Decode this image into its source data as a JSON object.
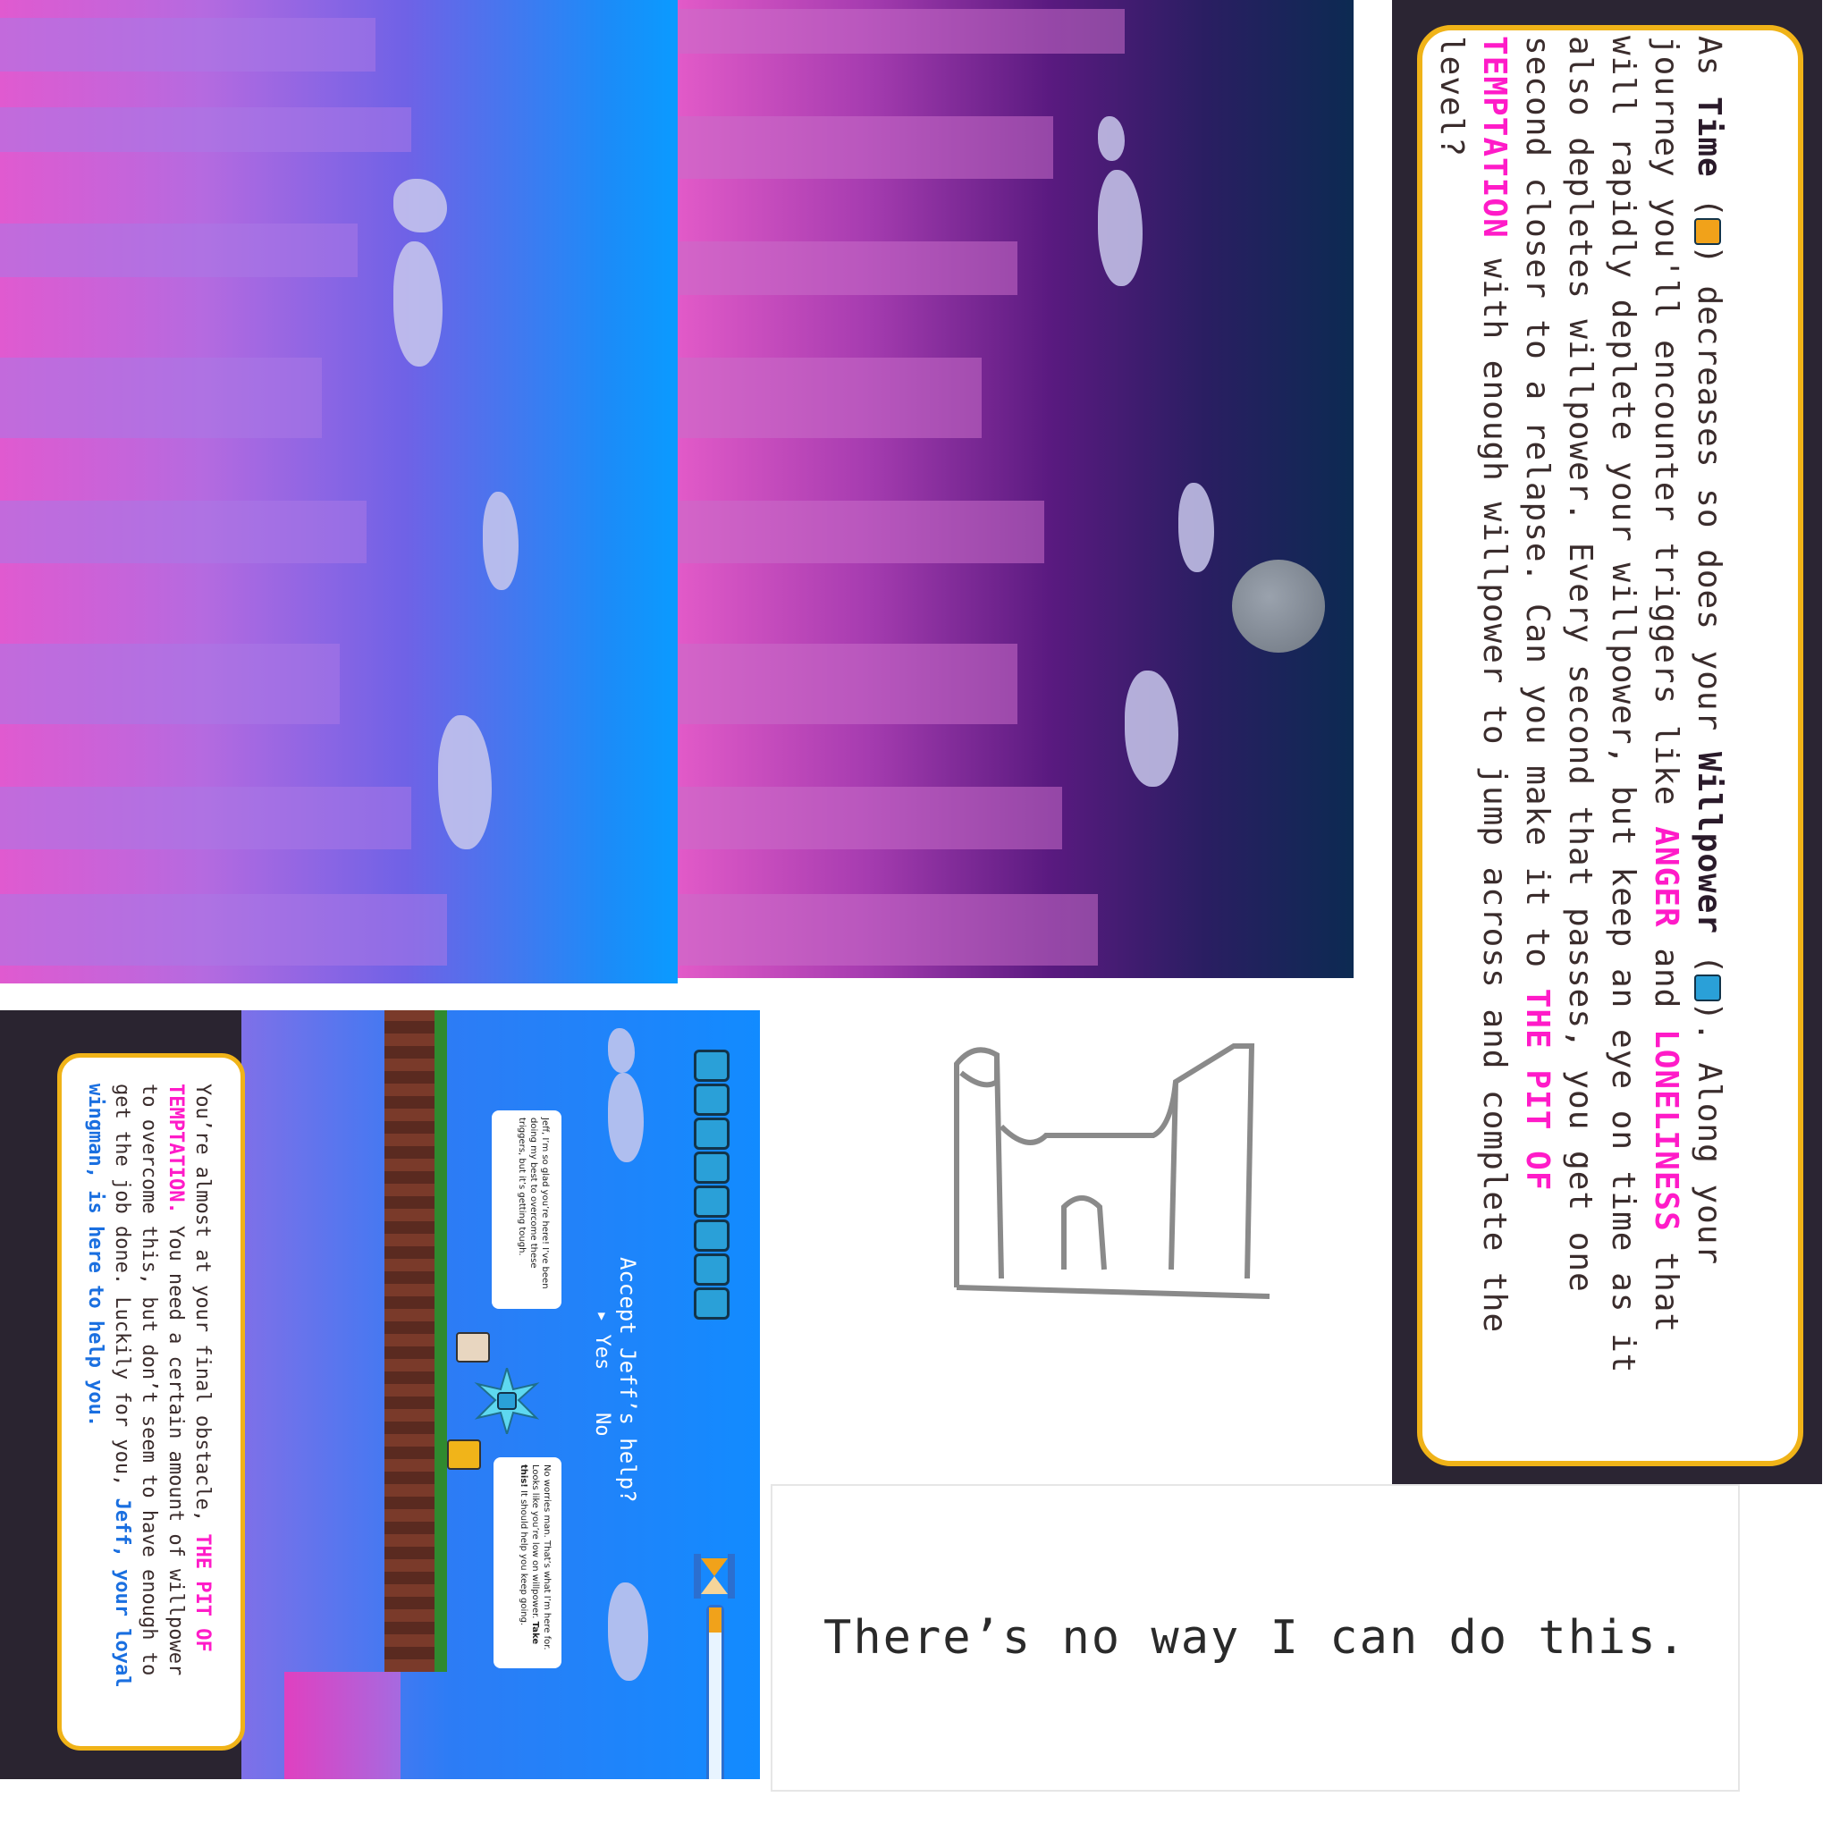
{
  "instructions": {
    "segments": [
      {
        "t": "As ",
        "s": ""
      },
      {
        "t": "Time",
        "s": "dark"
      },
      {
        "t": " (",
        "s": ""
      },
      {
        "t": "",
        "s": "hourglass-icon"
      },
      {
        "t": ") decreases so does your ",
        "s": ""
      },
      {
        "t": "Willpower",
        "s": "dark"
      },
      {
        "t": " (",
        "s": ""
      },
      {
        "t": "",
        "s": "fist-icon"
      },
      {
        "t": "). Along your journey you'll encounter triggers like ",
        "s": ""
      },
      {
        "t": "ANGER",
        "s": "pink"
      },
      {
        "t": " and ",
        "s": ""
      },
      {
        "t": "LONELINESS",
        "s": "pink"
      },
      {
        "t": " that will rapidly deplete your willpower, but keep an eye on time as it also depletes willpower. Every second that passes, you get one second closer to a relapse. Can you make it to ",
        "s": ""
      },
      {
        "t": "THE PIT OF TEMPTATION",
        "s": "pink"
      },
      {
        "t": " with enough willpower to jump across and complete the level?",
        "s": ""
      }
    ]
  },
  "quote": "There’s no way I can do this.",
  "game": {
    "story_segments": [
      {
        "t": "You’re almost at your final obstacle, ",
        "s": ""
      },
      {
        "t": "THE PIT OF TEMPTATION.",
        "s": "pink"
      },
      {
        "t": " You need a certain amount of willpower to overcome this, but don’t seem to have enough to get the job done. Luckily for you, ",
        "s": ""
      },
      {
        "t": "Jeff, your loyal wingman, is here to help you.",
        "s": "blue"
      }
    ],
    "bubble_player": "Jeff, I’m so glad you’re here! I’ve been doing my best to overcome these triggers, but it’s getting tough.",
    "bubble_jeff_a": "No worries man. That’s what I’m here for. Looks like you’re low on willpower. ",
    "bubble_jeff_b": "Take this!",
    "bubble_jeff_c": " It should help you keep going.",
    "prompt_question": "Accept Jeff’s help?",
    "option_yes": "Yes",
    "option_no": "No",
    "selector": "▸",
    "willpower_count": 8,
    "timer_fraction": 0.12
  },
  "colors": {
    "accent_pink": "#ff1bc8",
    "frame_gold": "#f0b318",
    "panel_dark": "#2b2533"
  }
}
